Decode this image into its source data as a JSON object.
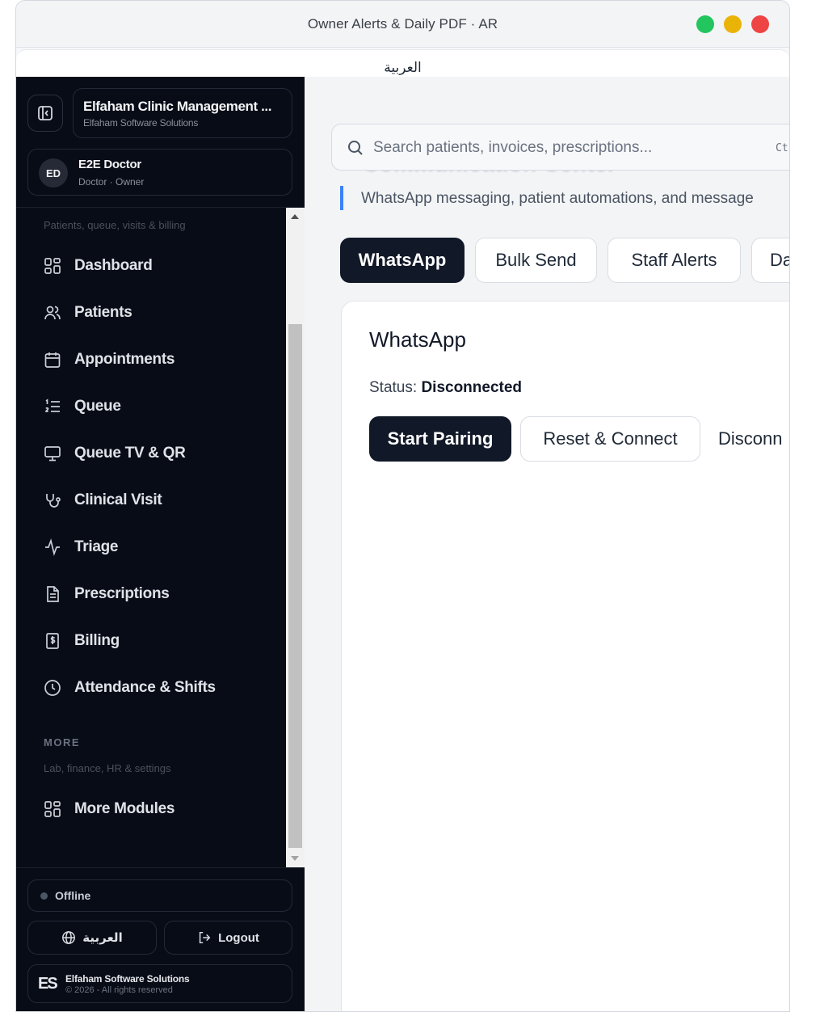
{
  "window": {
    "title": "Owner Alerts & Daily PDF · AR",
    "language_label": "العربية"
  },
  "sidebar": {
    "brand_name": "Elfaham Clinic Management ...",
    "brand_sub": "Elfaham Software Solutions",
    "user_initials": "ED",
    "user_name": "E2E Doctor",
    "user_role": "Doctor · Owner",
    "section_hint": "Patients, queue, visits & billing",
    "items": [
      {
        "label": "Dashboard",
        "icon": "dashboard-icon"
      },
      {
        "label": "Patients",
        "icon": "users-icon"
      },
      {
        "label": "Appointments",
        "icon": "calendar-icon"
      },
      {
        "label": "Queue",
        "icon": "list-ordered-icon"
      },
      {
        "label": "Queue TV & QR",
        "icon": "monitor-icon"
      },
      {
        "label": "Clinical Visit",
        "icon": "stethoscope-icon"
      },
      {
        "label": "Triage",
        "icon": "activity-icon"
      },
      {
        "label": "Prescriptions",
        "icon": "file-text-icon"
      },
      {
        "label": "Billing",
        "icon": "receipt-icon"
      },
      {
        "label": "Attendance & Shifts",
        "icon": "clock-icon"
      }
    ],
    "more_heading": "MORE",
    "more_hint": "Lab, finance, HR & settings",
    "more_item": {
      "label": "More Modules",
      "icon": "dashboard-icon"
    },
    "status": "Offline",
    "lang_button": "العربية",
    "logout_button": "Logout",
    "footer_logo": "ES",
    "footer_company": "Elfaham Software Solutions",
    "footer_rights": "© 2026 - All rights reserved"
  },
  "main": {
    "search_placeholder": "Search patients, invoices, prescriptions...",
    "search_shortcut": "Ct",
    "page_title": "Communication Center",
    "subtitle": "WhatsApp messaging, patient automations, and message",
    "tabs": [
      {
        "label": "WhatsApp",
        "active": true
      },
      {
        "label": "Bulk Send",
        "active": false
      },
      {
        "label": "Staff Alerts",
        "active": false
      },
      {
        "label": "Da",
        "active": false
      }
    ],
    "card": {
      "title": "WhatsApp",
      "status_label": "Status:",
      "status_value": "Disconnected",
      "start_button": "Start Pairing",
      "reset_button": "Reset & Connect",
      "disconnect_button": "Disconn"
    }
  },
  "colors": {
    "sidebar_bg": "#080c17",
    "accent": "#3b82f6",
    "primary_button": "#111827",
    "traffic_green": "#22c55e",
    "traffic_yellow": "#eab308",
    "traffic_red": "#ef4444"
  }
}
